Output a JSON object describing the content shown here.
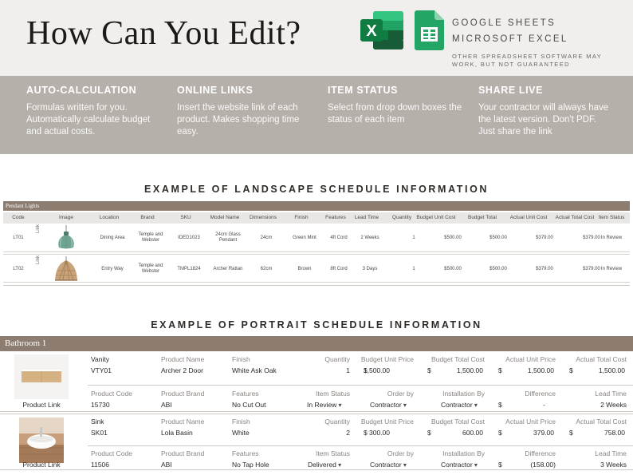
{
  "header": {
    "title": "How Can You Edit?",
    "software": [
      "GOOGLE SHEETS",
      "MICROSOFT EXCEL"
    ],
    "note": "OTHER SPREADSHEET SOFTWARE MAY WORK, BUT NOT GUARANTEED",
    "excel_letter": "X",
    "colors": {
      "band": "#b5b0aa",
      "category": "#8c7d70",
      "excel": "#1f7a45",
      "sheets": "#23a566"
    }
  },
  "features": [
    {
      "title": "AUTO-CALCULATION",
      "body": "Formulas written for you. Automatically calculate budget and actual costs."
    },
    {
      "title": "ONLINE LINKS",
      "body": "Insert the website link of each product. Makes shopping time easy."
    },
    {
      "title": "ITEM STATUS",
      "body": "Select from drop down boxes the status of each item"
    },
    {
      "title": "SHARE LIVE",
      "body": "Your contractor will always have the latest version. Don't PDF. Just share the link"
    }
  ],
  "landscape": {
    "section_title": "EXAMPLE OF LANDSCAPE SCHEDULE INFORMATION",
    "category": "Pendant Lights",
    "columns": [
      "Code",
      "Image",
      "Location",
      "Brand",
      "SKU",
      "Model Name",
      "Dimensions",
      "Finish",
      "Features",
      "Lead Time",
      "Quantity",
      "Budget Unit Cost",
      "Budget Total",
      "Actual Unit Cost",
      "Actual Total Cost",
      "Item Status"
    ],
    "link_label": "Link",
    "rows": [
      {
        "code": "LT01",
        "location": "Dining Area",
        "brand": "Temple and Webster",
        "sku": "IDED1023",
        "model": "24cm Glass Pendant",
        "dimensions": "24cm",
        "finish": "Green Mint",
        "features": "4ft Cord",
        "lead_time": "2 Weeks",
        "quantity": "1",
        "budget_unit": "$500.00",
        "budget_total": "$500.00",
        "actual_unit": "$379.00",
        "actual_total": "$379.00",
        "status": "In Review"
      },
      {
        "code": "LT02",
        "location": "Entry Way",
        "brand": "Temple and Webster",
        "sku": "TMPL1824",
        "model": "Archer Rattan",
        "dimensions": "62cm",
        "finish": "Brown",
        "features": "8ft Cord",
        "lead_time": "3 Days",
        "quantity": "1",
        "budget_unit": "$500.00",
        "budget_total": "$500.00",
        "actual_unit": "$379.00",
        "actual_total": "$379.00",
        "status": "In Review"
      }
    ]
  },
  "portrait": {
    "section_title": "EXAMPLE OF PORTRAIT SCHEDULE INFORMATION",
    "category": "Bathroom 1",
    "labels": {
      "product_name": "Product Name",
      "finish": "Finish",
      "quantity": "Quantity",
      "budget_unit": "Budget Unit Price",
      "budget_total": "Budget Total Cost",
      "actual_unit": "Actual Unit Price",
      "actual_total": "Actual Total Cost",
      "product_code": "Product Code",
      "product_brand": "Product Brand",
      "features": "Features",
      "item_status": "Item Status",
      "order_by": "Order by",
      "installation_by": "Installation By",
      "difference": "Difference",
      "lead_time": "Lead Time",
      "product_link": "Product Link",
      "currency": "$"
    },
    "items": [
      {
        "type": "Vanity",
        "code": "VTY01",
        "product_name": "Archer 2 Door",
        "finish": "White Ask Oak",
        "quantity": "1",
        "budget_unit": "1,500.00",
        "budget_total": "1,500.00",
        "actual_unit": "1,500.00",
        "actual_total": "1,500.00",
        "product_code": "15730",
        "product_brand": "ABI",
        "features": "No Cut Out",
        "item_status": "In Review",
        "order_by": "Contractor",
        "installation_by": "Contractor",
        "difference": "-",
        "lead_time": "2 Weeks"
      },
      {
        "type": "Sink",
        "code": "SK01",
        "product_name": "Lola Basin",
        "finish": "White",
        "quantity": "2",
        "budget_unit": "300.00",
        "budget_total": "600.00",
        "actual_unit": "379.00",
        "actual_total": "758.00",
        "product_code": "11506",
        "product_brand": "ABI",
        "features": "No Tap Hole",
        "item_status": "Delivered",
        "order_by": "Contractor",
        "installation_by": "Contractor",
        "difference": "(158.00)",
        "lead_time": "3 Weeks"
      }
    ]
  }
}
